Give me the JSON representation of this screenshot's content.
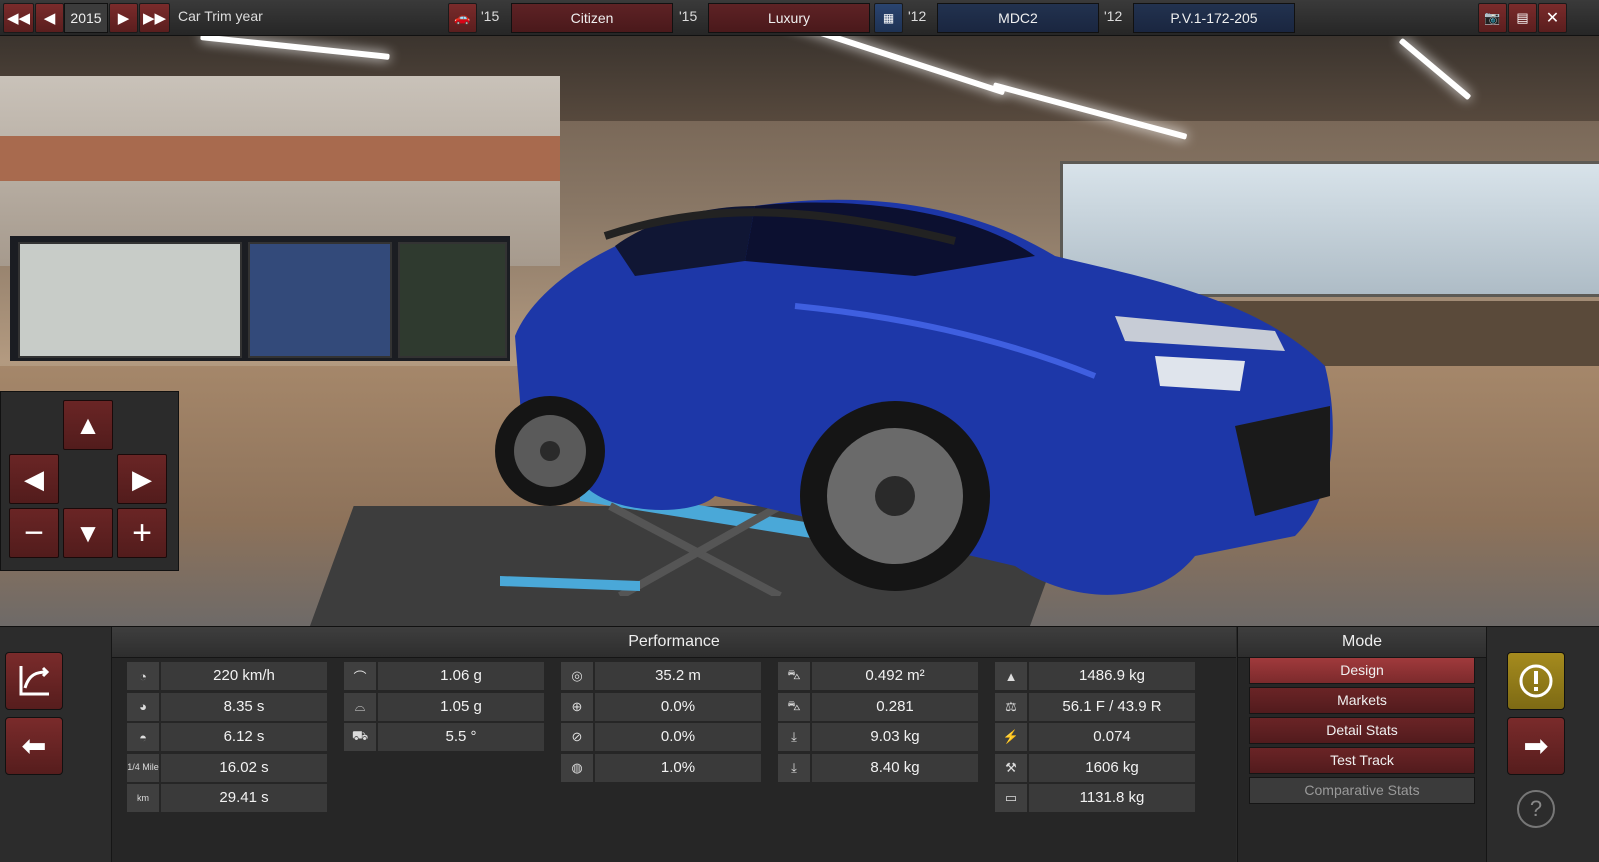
{
  "topbar": {
    "year": "2015",
    "year_label": "Car Trim year",
    "model_year": "'15",
    "model_name": "Citizen",
    "trim_year": "'15",
    "trim_name": "Luxury",
    "engine_year": "'12",
    "engine_name": "MDC2",
    "variant_year": "'12",
    "variant_name": "P.V.1-172-205"
  },
  "performance": {
    "title": "Performance",
    "columns": [
      [
        {
          "icon": "top-speed-icon",
          "value": "220 km/h"
        },
        {
          "icon": "acceleration-100-icon",
          "value": "8.35 s"
        },
        {
          "icon": "acceleration-80-icon",
          "value": "6.12 s"
        },
        {
          "icon": "quarter-mile-icon",
          "icon_text": "1/4 Mile",
          "value": "16.02 s"
        },
        {
          "icon": "kilometer-icon",
          "icon_text": "km",
          "value": "29.41 s"
        }
      ],
      [
        {
          "icon": "cornering-g-icon",
          "value": "1.06 g"
        },
        {
          "icon": "cornering-g2-icon",
          "value": "1.05 g"
        },
        {
          "icon": "body-roll-icon",
          "value": "5.5 °"
        }
      ],
      [
        {
          "icon": "braking-distance-icon",
          "value": "35.2 m"
        },
        {
          "icon": "understeer-icon",
          "value": "0.0%"
        },
        {
          "icon": "brake-fade-icon",
          "value": "0.0%"
        },
        {
          "icon": "tire-wear-icon",
          "value": "1.0%"
        }
      ],
      [
        {
          "icon": "frontal-area-icon",
          "value": "0.492 m²"
        },
        {
          "icon": "drag-coefficient-icon",
          "value": "0.281"
        },
        {
          "icon": "front-downforce-icon",
          "value": "9.03 kg"
        },
        {
          "icon": "rear-downforce-icon",
          "value": "8.40 kg"
        }
      ],
      [
        {
          "icon": "weight-icon",
          "value": "1486.9 kg"
        },
        {
          "icon": "weight-distribution-icon",
          "value": "56.1 F / 43.9 R"
        },
        {
          "icon": "power-weight-icon",
          "value": "0.074"
        },
        {
          "icon": "towing-icon",
          "value": "1606 kg"
        },
        {
          "icon": "cargo-icon",
          "value": "1131.8 kg"
        }
      ]
    ]
  },
  "mode": {
    "title": "Mode",
    "items": [
      "Design",
      "Markets",
      "Detail Stats",
      "Test Track",
      "Comparative Stats"
    ]
  }
}
